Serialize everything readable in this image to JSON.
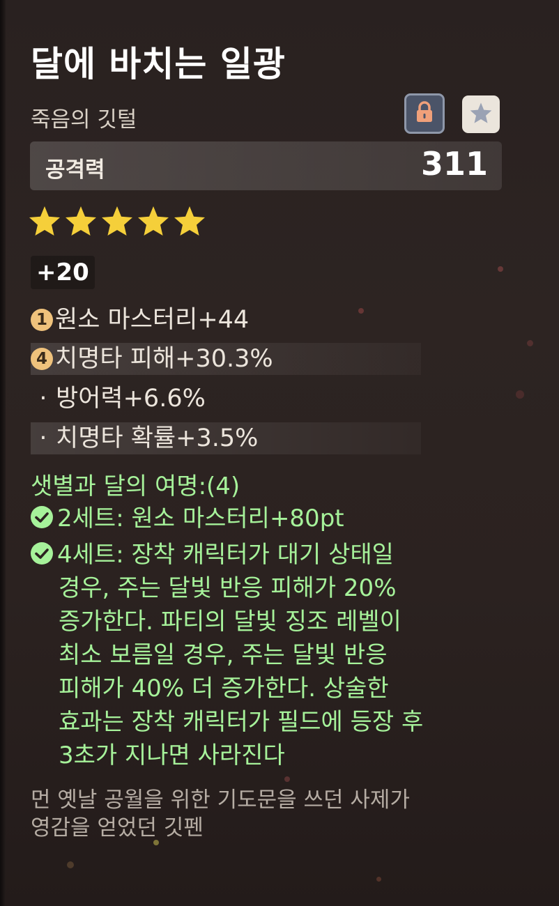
{
  "artifact": {
    "name": "달에 바치는 일광",
    "slot": "죽음의 깃털",
    "main_stat": {
      "label": "공격력",
      "value": "311"
    },
    "rarity_stars": 5,
    "level": "+20",
    "substats": [
      {
        "badge": "1",
        "text": "원소 마스터리+44"
      },
      {
        "badge": "4",
        "text": "치명타 피해+30.3%"
      },
      {
        "bullet": "·",
        "text": "방어력+6.6%"
      },
      {
        "bullet": "·",
        "text": "치명타 확률+3.5%"
      }
    ]
  },
  "set": {
    "name": "샛별과 달의 여명:(4)",
    "two_piece": "2세트: 원소 마스터리+80pt",
    "four_piece_lines": [
      "4세트: 장착 캐릭터가 대기 상태일",
      "경우, 주는 달빛 반응 피해가 20%",
      "증가한다. 파티의 달빛 징조 레벨이",
      "최소 보름일 경우, 주는 달빛 반응",
      "피해가 40% 더 증가한다. 상술한",
      "효과는 장착 캐릭터가 필드에 등장 후",
      "3초가 지나면 사라진다"
    ]
  },
  "lore_lines": [
    "먼 옛날 공월을 위한 기도문을 쓰던 사제가",
    "영감을 얻었던 깃펜"
  ],
  "icons": {
    "lock": "lock-icon",
    "favorite": "star-icon",
    "rarity": "rarity-star-icon",
    "set_active": "checkmark-circle-icon"
  },
  "colors": {
    "background": "#2b2220",
    "set_text_green": "#a6f29a",
    "star_gold": "#f5cf3a",
    "lock_button": "#4b5468",
    "lock_glyph": "#f0a07a",
    "lore_text": "#b6ada4"
  }
}
